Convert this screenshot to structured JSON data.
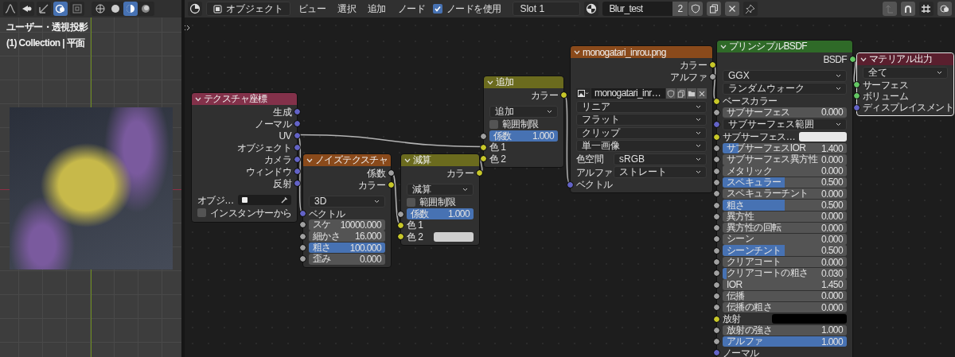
{
  "viewport": {
    "overlay_text": [
      "ユーザー・透視投影",
      "(1) Collection | 平面"
    ]
  },
  "header": {
    "mode": "オブジェクト",
    "menus": [
      "ビュー",
      "選択",
      "追加",
      "ノード"
    ],
    "use_nodes": {
      "label": "ノードを使用",
      "checked": true
    },
    "slot": "Slot 1",
    "material": {
      "name": "Blur_test",
      "users": "2"
    }
  },
  "nodes": [
    {
      "title": "テクスチャ座標",
      "color": "#83314a",
      "selected": false,
      "rows": [
        {
          "kind": "output",
          "label": "生成",
          "color": "#6363c7"
        },
        {
          "kind": "output",
          "label": "ノーマル",
          "color": "#6363c7"
        },
        {
          "kind": "output",
          "label": "UV",
          "color": "#6363c7"
        },
        {
          "kind": "output",
          "label": "オブジェクト",
          "color": "#6363c7"
        },
        {
          "kind": "output",
          "label": "カメラ",
          "color": "#6363c7"
        },
        {
          "kind": "output",
          "label": "ウィンドウ",
          "color": "#6363c7"
        },
        {
          "kind": "output",
          "label": "反射",
          "color": "#6363c7"
        },
        {
          "kind": "object",
          "label": "オブジ…"
        },
        {
          "kind": "checkbox",
          "label": "インスタンサーから",
          "checked": false
        }
      ]
    },
    {
      "title": "ノイズテクスチャ",
      "color": "#8a4a1b",
      "selected": false,
      "rows": [
        {
          "kind": "output",
          "label": "係数",
          "color": "#a1a1a1"
        },
        {
          "kind": "output",
          "label": "カラー",
          "color": "#c7c729"
        },
        {
          "kind": "dropdown",
          "label": "3D"
        },
        {
          "kind": "input",
          "label": "ベクトル",
          "color": "#6363c7"
        },
        {
          "kind": "number",
          "label": "スケ",
          "value": "10000.000",
          "color": "#a1a1a1"
        },
        {
          "kind": "number",
          "label": "細かさ",
          "value": "16.000",
          "color": "#a1a1a1"
        },
        {
          "kind": "slider",
          "label": "粗さ",
          "value": "100.000",
          "level": 1,
          "color": "#a1a1a1"
        },
        {
          "kind": "number",
          "label": "歪み",
          "value": "0.000",
          "color": "#a1a1a1"
        }
      ]
    },
    {
      "title": "減算",
      "color": "#6b6b1e",
      "selected": false,
      "rows": [
        {
          "kind": "output",
          "label": "カラー",
          "color": "#c7c729"
        },
        {
          "kind": "dropdown",
          "label": "減算"
        },
        {
          "kind": "checkbox",
          "label": "範囲制限",
          "checked": false
        },
        {
          "kind": "slider",
          "label": "係数",
          "value": "1.000",
          "level": 1,
          "color": "#a1a1a1"
        },
        {
          "kind": "input",
          "label": "色 1",
          "color": "#c7c729"
        },
        {
          "kind": "color",
          "label": "色 2",
          "swatch": {
            "color": "#cfcfcf"
          },
          "color": "#c7c729"
        }
      ]
    },
    {
      "title": "追加",
      "color": "#6b6b1e",
      "selected": false,
      "rows": [
        {
          "kind": "output",
          "label": "カラー",
          "color": "#c7c729"
        },
        {
          "kind": "dropdown",
          "label": "追加"
        },
        {
          "kind": "checkbox",
          "label": "範囲制限",
          "checked": false
        },
        {
          "kind": "slider",
          "label": "係数",
          "value": "1.000",
          "level": 1,
          "color": "#a1a1a1"
        },
        {
          "kind": "input",
          "label": "色 1",
          "color": "#c7c729"
        },
        {
          "kind": "input",
          "label": "色 2",
          "color": "#c7c729"
        }
      ]
    },
    {
      "title": "monogatari_inrou.png",
      "color": "#8a4a1b",
      "selected": false,
      "rows": [
        {
          "kind": "output",
          "label": "カラー",
          "color": "#c7c729"
        },
        {
          "kind": "output",
          "label": "アルファ",
          "color": "#a1a1a1"
        },
        {
          "kind": "field",
          "label": "monogatari_inr…"
        },
        {
          "kind": "dropdown",
          "label": "リニア"
        },
        {
          "kind": "dropdown",
          "label": "フラット"
        },
        {
          "kind": "dropdown",
          "label": "クリップ"
        },
        {
          "kind": "dropdown",
          "label": "単一画像"
        },
        {
          "kind": "prop",
          "label": "色空間",
          "value": "sRGB"
        },
        {
          "kind": "prop",
          "label": "アルファ",
          "value": "ストレート"
        },
        {
          "kind": "input",
          "label": "ベクトル",
          "color": "#6363c7"
        }
      ]
    },
    {
      "title": "プリンシプルBSDF",
      "color": "#2f6a28",
      "selected": false,
      "rows": [
        {
          "kind": "output",
          "label": "BSDF",
          "color": "#63c763"
        },
        {
          "kind": "dropdown",
          "label": "GGX"
        },
        {
          "kind": "dropdown",
          "label": "ランダムウォーク"
        },
        {
          "kind": "input",
          "label": "ベースカラー",
          "color": "#c7c729"
        },
        {
          "kind": "number",
          "label": "サブサーフェス",
          "value": "0.000",
          "color": "#a1a1a1"
        },
        {
          "kind": "dropdown",
          "label": "サブサーフェス範囲",
          "color": "#6363c7"
        },
        {
          "kind": "color",
          "label": "サブサーフェス…",
          "swatch": {
            "color": "#e8e8e8"
          },
          "color": "#c7c729"
        },
        {
          "kind": "slider",
          "label": "サブサーフェスIOR",
          "value": "1.400",
          "level": 0.125,
          "color": "#a1a1a1"
        },
        {
          "kind": "number",
          "label": "サブサーフェス異方性",
          "value": "0.000",
          "color": "#a1a1a1"
        },
        {
          "kind": "number",
          "label": "メタリック",
          "value": "0.000",
          "color": "#a1a1a1"
        },
        {
          "kind": "slider",
          "label": "スペキュラー",
          "value": "0.500",
          "level": 0.5,
          "color": "#a1a1a1"
        },
        {
          "kind": "number",
          "label": "スペキュラーチント",
          "value": "0.000",
          "color": "#a1a1a1"
        },
        {
          "kind": "slider",
          "label": "粗さ",
          "value": "0.500",
          "level": 0.5,
          "color": "#a1a1a1"
        },
        {
          "kind": "number",
          "label": "異方性",
          "value": "0.000",
          "color": "#a1a1a1"
        },
        {
          "kind": "number",
          "label": "異方性の回転",
          "value": "0.000",
          "color": "#a1a1a1"
        },
        {
          "kind": "number",
          "label": "シーン",
          "value": "0.000",
          "color": "#a1a1a1"
        },
        {
          "kind": "slider",
          "label": "シーンチント",
          "value": "0.500",
          "level": 0.5,
          "color": "#a1a1a1"
        },
        {
          "kind": "number",
          "label": "クリアコート",
          "value": "0.000",
          "color": "#a1a1a1"
        },
        {
          "kind": "slider",
          "label": "クリアコートの粗さ",
          "value": "0.030",
          "level": 0.03,
          "color": "#a1a1a1"
        },
        {
          "kind": "number",
          "label": "IOR",
          "value": "1.450",
          "color": "#a1a1a1"
        },
        {
          "kind": "number",
          "label": "伝播",
          "value": "0.000",
          "color": "#a1a1a1"
        },
        {
          "kind": "number",
          "label": "伝播の粗さ",
          "value": "0.000",
          "color": "#a1a1a1"
        },
        {
          "kind": "color",
          "label": "放射",
          "swatch": {
            "color": "#000000"
          },
          "color": "#c7c729"
        },
        {
          "kind": "number",
          "label": "放射の強さ",
          "value": "1.000",
          "color": "#a1a1a1"
        },
        {
          "kind": "slider",
          "label": "アルファ",
          "value": "1.000",
          "level": 1,
          "color": "#a1a1a1"
        },
        {
          "kind": "input",
          "label": "ノーマル",
          "color": "#6363c7"
        }
      ]
    },
    {
      "title": "マテリアル出力",
      "color": "#5a1f2e",
      "selected": true,
      "rows": [
        {
          "kind": "dropdown",
          "label": "全て"
        },
        {
          "kind": "input",
          "label": "サーフェス",
          "color": "#63c763"
        },
        {
          "kind": "input",
          "label": "ボリューム",
          "color": "#63c763"
        },
        {
          "kind": "input",
          "label": "ディスプレイスメント",
          "color": "#6363c7"
        }
      ]
    }
  ]
}
